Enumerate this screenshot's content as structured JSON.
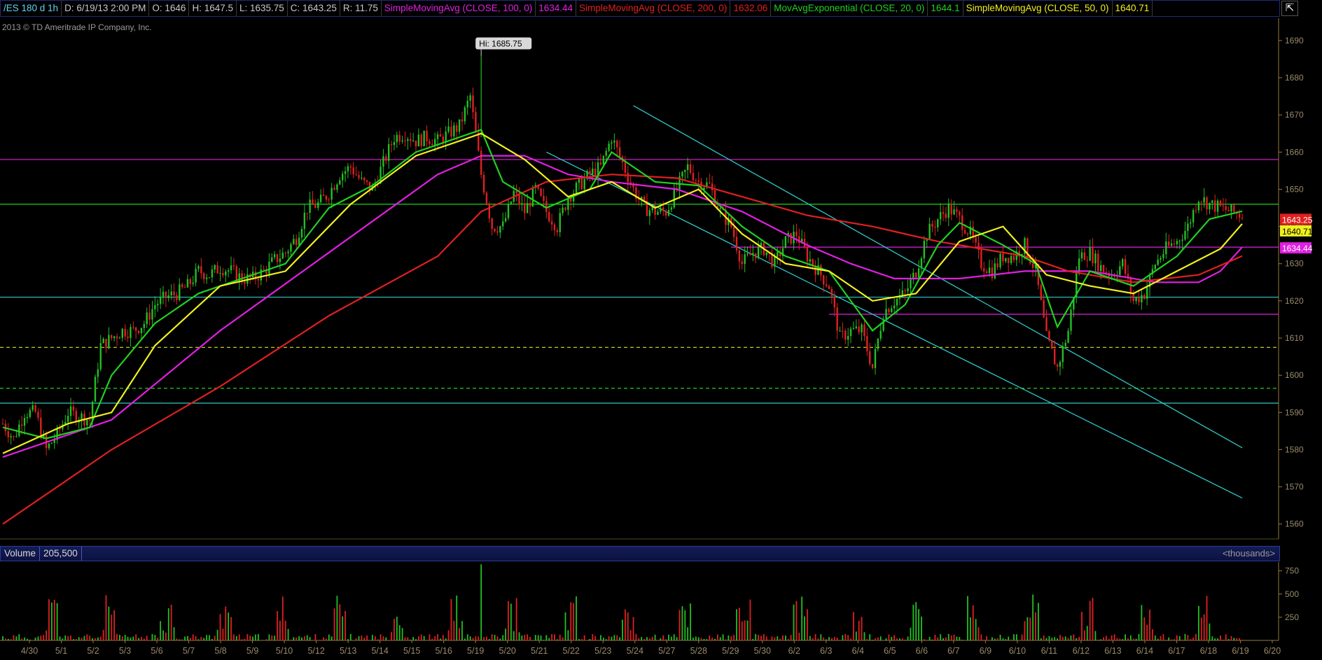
{
  "header": {
    "symbol": "/ES 180 d 1h",
    "date": "D: 6/19/13 2:00 PM",
    "open": "O: 1646",
    "high": "H: 1647.5",
    "low": "L: 1635.75",
    "close": "C: 1643.25",
    "range": "R: 11.75",
    "studies": [
      {
        "label": "SimpleMovingAvg (CLOSE, 100, 0)",
        "value": "1634.44",
        "color": "#e020e0"
      },
      {
        "label": "SimpleMovingAvg (CLOSE, 200, 0)",
        "value": "1632.06",
        "color": "#e02020"
      },
      {
        "label": "MovAvgExponential (CLOSE, 20, 0)",
        "value": "1644.1",
        "color": "#20d020"
      },
      {
        "label": "SimpleMovingAvg (CLOSE, 50, 0)",
        "value": "1640.71",
        "color": "#f0f020"
      }
    ]
  },
  "copyright": "2013 © TD Ameritrade IP Company, Inc.",
  "volume_header": {
    "label": "Volume",
    "value": "205,500",
    "units": "<thousands>"
  },
  "colors": {
    "up": "#22c022",
    "down": "#e02020",
    "axis": "#9a7a3a",
    "background": "#000000"
  },
  "chart_data": [
    {
      "type": "candlestick",
      "title": "/ES 180 d 1h",
      "ylim": [
        1556,
        1696
      ],
      "yticks": [
        1560,
        1570,
        1580,
        1590,
        1600,
        1610,
        1620,
        1630,
        1640,
        1650,
        1660,
        1670,
        1680,
        1690
      ],
      "x_labels": [
        "4/30",
        "5/1",
        "5/2",
        "5/3",
        "5/6",
        "5/7",
        "5/8",
        "5/9",
        "5/10",
        "5/12",
        "5/13",
        "5/14",
        "5/15",
        "5/16",
        "5/19",
        "5/20",
        "5/21",
        "5/22",
        "5/23",
        "5/24",
        "5/27",
        "5/28",
        "5/29",
        "5/30",
        "6/2",
        "6/3",
        "6/4",
        "6/5",
        "6/6",
        "6/7",
        "6/9",
        "6/10",
        "6/11",
        "6/12",
        "6/13",
        "6/14",
        "6/17",
        "6/18",
        "6/19",
        "6/20"
      ],
      "annotation": "Hi: 1685.75",
      "price_tags": [
        {
          "value": "1643.25",
          "color": "#e02020"
        },
        {
          "value": "1640.71",
          "color": "#f0f020"
        },
        {
          "value": "1634.44",
          "color": "#e020e0"
        }
      ],
      "close_path": [
        [
          0,
          1587
        ],
        [
          1,
          1583
        ],
        [
          2,
          1590
        ],
        [
          3,
          1590
        ],
        [
          4,
          1580
        ],
        [
          5,
          1584
        ],
        [
          6,
          1590
        ],
        [
          7,
          1589
        ],
        [
          8,
          1588
        ],
        [
          9,
          1608
        ],
        [
          10,
          1610
        ],
        [
          11,
          1612
        ],
        [
          12,
          1612
        ],
        [
          13,
          1614
        ],
        [
          14,
          1619
        ],
        [
          15,
          1621
        ],
        [
          16,
          1622
        ],
        [
          17,
          1624
        ],
        [
          18,
          1628
        ],
        [
          19,
          1627
        ],
        [
          20,
          1629
        ],
        [
          21,
          1628
        ],
        [
          22,
          1626
        ],
        [
          23,
          1626
        ],
        [
          24,
          1628
        ],
        [
          25,
          1631
        ],
        [
          26,
          1633
        ],
        [
          27,
          1637
        ],
        [
          28,
          1645
        ],
        [
          29,
          1646
        ],
        [
          30,
          1649
        ],
        [
          31,
          1654
        ],
        [
          32,
          1656
        ],
        [
          33,
          1652
        ],
        [
          34,
          1650
        ],
        [
          35,
          1657
        ],
        [
          36,
          1664
        ],
        [
          37,
          1665
        ],
        [
          38,
          1663
        ],
        [
          39,
          1664
        ],
        [
          40,
          1663
        ],
        [
          41,
          1665
        ],
        [
          42,
          1667
        ],
        [
          43,
          1675
        ],
        [
          44,
          1654
        ],
        [
          45,
          1640
        ],
        [
          46,
          1640
        ],
        [
          47,
          1649
        ],
        [
          48,
          1644
        ],
        [
          49,
          1650
        ],
        [
          50,
          1644
        ],
        [
          51,
          1640
        ],
        [
          52,
          1648
        ],
        [
          53,
          1651
        ],
        [
          54,
          1654
        ],
        [
          55,
          1656
        ],
        [
          56,
          1664
        ],
        [
          57,
          1657
        ],
        [
          58,
          1650
        ],
        [
          59,
          1645
        ],
        [
          60,
          1644
        ],
        [
          61,
          1644
        ],
        [
          62,
          1650
        ],
        [
          63,
          1656
        ],
        [
          64,
          1652
        ],
        [
          65,
          1651
        ],
        [
          66,
          1644
        ],
        [
          67,
          1640
        ],
        [
          68,
          1630
        ],
        [
          69,
          1633
        ],
        [
          70,
          1634
        ],
        [
          71,
          1630
        ],
        [
          72,
          1636
        ],
        [
          73,
          1638
        ],
        [
          74,
          1632
        ],
        [
          75,
          1628
        ],
        [
          76,
          1624
        ],
        [
          77,
          1610
        ],
        [
          78,
          1612
        ],
        [
          79,
          1612
        ],
        [
          80,
          1602
        ],
        [
          81,
          1617
        ],
        [
          82,
          1620
        ],
        [
          83,
          1622
        ],
        [
          84,
          1628
        ],
        [
          85,
          1638
        ],
        [
          86,
          1642
        ],
        [
          87,
          1645
        ],
        [
          88,
          1642
        ],
        [
          89,
          1638
        ],
        [
          90,
          1630
        ],
        [
          91,
          1628
        ],
        [
          92,
          1632
        ],
        [
          93,
          1632
        ],
        [
          94,
          1635
        ],
        [
          95,
          1628
        ],
        [
          96,
          1610
        ],
        [
          97,
          1602
        ],
        [
          98,
          1612
        ],
        [
          99,
          1632
        ],
        [
          100,
          1633
        ],
        [
          101,
          1629
        ],
        [
          102,
          1627
        ],
        [
          103,
          1630
        ],
        [
          104,
          1620
        ],
        [
          105,
          1622
        ],
        [
          106,
          1630
        ],
        [
          107,
          1634
        ],
        [
          108,
          1636
        ],
        [
          109,
          1640
        ],
        [
          110,
          1648
        ],
        [
          111,
          1646
        ],
        [
          112,
          1645
        ],
        [
          113,
          1644
        ],
        [
          114,
          1643
        ]
      ],
      "series": [
        {
          "name": "SimpleMovingAvg (CLOSE, 100, 0)",
          "color": "#e020e0",
          "points": [
            [
              0,
              1578
            ],
            [
              10,
              1588
            ],
            [
              20,
              1612
            ],
            [
              30,
              1633
            ],
            [
              40,
              1654
            ],
            [
              44,
              1659
            ],
            [
              48,
              1659
            ],
            [
              52,
              1654
            ],
            [
              56,
              1652
            ],
            [
              62,
              1650
            ],
            [
              68,
              1644
            ],
            [
              74,
              1635
            ],
            [
              78,
              1630
            ],
            [
              82,
              1626
            ],
            [
              88,
              1626
            ],
            [
              94,
              1628
            ],
            [
              100,
              1628
            ],
            [
              106,
              1625
            ],
            [
              110,
              1625
            ],
            [
              112,
              1628
            ],
            [
              114,
              1634.44
            ]
          ]
        },
        {
          "name": "SimpleMovingAvg (CLOSE, 200, 0)",
          "color": "#e02020",
          "points": [
            [
              0,
              1560
            ],
            [
              10,
              1580
            ],
            [
              20,
              1597
            ],
            [
              30,
              1616
            ],
            [
              40,
              1632
            ],
            [
              44,
              1644
            ],
            [
              50,
              1652
            ],
            [
              56,
              1654
            ],
            [
              62,
              1653
            ],
            [
              68,
              1648
            ],
            [
              74,
              1643
            ],
            [
              80,
              1640
            ],
            [
              86,
              1636
            ],
            [
              90,
              1634
            ],
            [
              94,
              1632
            ],
            [
              98,
              1628
            ],
            [
              104,
              1625
            ],
            [
              110,
              1627
            ],
            [
              114,
              1632.06
            ]
          ]
        },
        {
          "name": "MovAvgExponential (CLOSE, 20, 0)",
          "color": "#20d020",
          "points": [
            [
              0,
              1586
            ],
            [
              4,
              1583
            ],
            [
              8,
              1586
            ],
            [
              10,
              1600
            ],
            [
              14,
              1614
            ],
            [
              18,
              1622
            ],
            [
              22,
              1626
            ],
            [
              26,
              1630
            ],
            [
              30,
              1645
            ],
            [
              34,
              1651
            ],
            [
              38,
              1660
            ],
            [
              42,
              1664
            ],
            [
              44,
              1666
            ],
            [
              46,
              1652
            ],
            [
              50,
              1645
            ],
            [
              54,
              1650
            ],
            [
              56,
              1660
            ],
            [
              60,
              1652
            ],
            [
              64,
              1651
            ],
            [
              68,
              1640
            ],
            [
              72,
              1632
            ],
            [
              76,
              1628
            ],
            [
              80,
              1612
            ],
            [
              83,
              1619
            ],
            [
              86,
              1635
            ],
            [
              88,
              1641
            ],
            [
              92,
              1635
            ],
            [
              95,
              1630
            ],
            [
              97,
              1613
            ],
            [
              100,
              1628
            ],
            [
              104,
              1624
            ],
            [
              108,
              1632
            ],
            [
              111,
              1642
            ],
            [
              114,
              1644.1
            ]
          ]
        },
        {
          "name": "SimpleMovingAvg (CLOSE, 50, 0)",
          "color": "#f0f020",
          "points": [
            [
              0,
              1579
            ],
            [
              6,
              1587
            ],
            [
              10,
              1590
            ],
            [
              14,
              1608
            ],
            [
              20,
              1624
            ],
            [
              26,
              1628
            ],
            [
              32,
              1646
            ],
            [
              38,
              1659
            ],
            [
              42,
              1663
            ],
            [
              44,
              1665
            ],
            [
              48,
              1658
            ],
            [
              52,
              1648
            ],
            [
              56,
              1652
            ],
            [
              60,
              1645
            ],
            [
              64,
              1650
            ],
            [
              68,
              1638
            ],
            [
              72,
              1630
            ],
            [
              76,
              1628
            ],
            [
              80,
              1620
            ],
            [
              84,
              1622
            ],
            [
              88,
              1636
            ],
            [
              92,
              1640
            ],
            [
              96,
              1627
            ],
            [
              100,
              1624
            ],
            [
              104,
              1622
            ],
            [
              108,
              1628
            ],
            [
              112,
              1634
            ],
            [
              114,
              1640.71
            ]
          ]
        }
      ],
      "horizontal_lines": [
        {
          "y": 1658,
          "color": "#e020e0",
          "style": "solid"
        },
        {
          "y": 1646,
          "color": "#20d020",
          "style": "solid"
        },
        {
          "y": 1634.44,
          "color": "#e020e0",
          "style": "solid",
          "from_x": 67
        },
        {
          "y": 1616.4,
          "color": "#e020e0",
          "style": "solid",
          "from_x": 76
        },
        {
          "y": 1621,
          "color": "#30c8c8",
          "style": "solid"
        },
        {
          "y": 1607.5,
          "color": "#e0e020",
          "style": "dashed"
        },
        {
          "y": 1596.5,
          "color": "#20d020",
          "style": "dashed"
        },
        {
          "y": 1592.5,
          "color": "#30c8c8",
          "style": "solid"
        }
      ],
      "trend_lines": [
        {
          "from": [
            58,
            1672.5
          ],
          "to": [
            114,
            1580.5
          ],
          "color": "#30c8c8"
        },
        {
          "from": [
            50,
            1660
          ],
          "to": [
            114,
            1567
          ],
          "color": "#30c8c8"
        }
      ]
    },
    {
      "type": "bar",
      "title": "Volume",
      "ylim": [
        0,
        800
      ],
      "yticks": [
        250,
        500,
        750
      ],
      "units": "<thousands>",
      "spike": {
        "x": 44,
        "value": 820
      }
    }
  ]
}
